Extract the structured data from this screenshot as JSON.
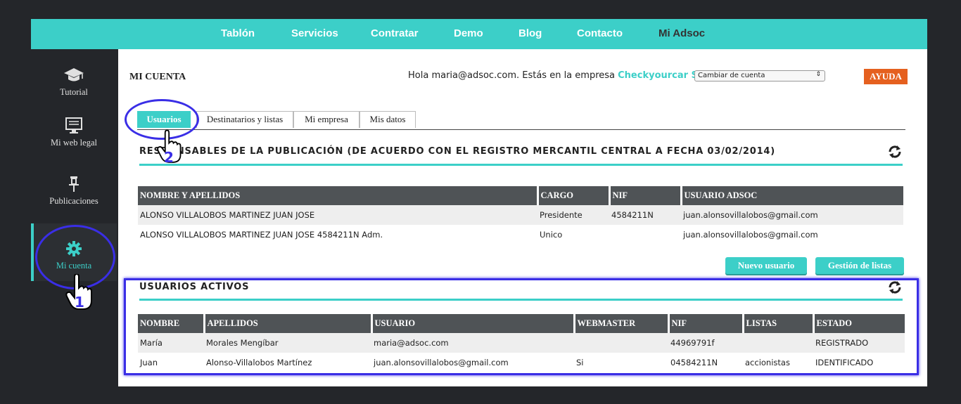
{
  "nav": {
    "items": [
      "Tablón",
      "Servicios",
      "Contratar",
      "Demo",
      "Blog",
      "Contacto",
      "Mi Adsoc"
    ]
  },
  "sidebar": {
    "items": [
      {
        "label": "Tutorial",
        "icon": "graduation-cap-icon"
      },
      {
        "label": "Mi web legal",
        "icon": "monitor-icon"
      },
      {
        "label": "Publicaciones",
        "icon": "pushpin-icon"
      },
      {
        "label": "Mi cuenta",
        "icon": "gear-icon"
      }
    ],
    "active": "Mi cuenta"
  },
  "header": {
    "title": "MI CUENTA",
    "greeting": "Hola maria@adsoc.com. Estás en la empresa",
    "company": "Checkyourcar S.L.",
    "account_select": "Cambiar de cuenta",
    "help_label": "AYUDA"
  },
  "tabs": [
    "Usuarios",
    "Destinatarios y listas",
    "Mi empresa",
    "Mis datos"
  ],
  "responsables": {
    "title": "RESPONSABLES DE LA PUBLICACIÓN (DE ACUERDO CON EL REGISTRO MERCANTIL CENTRAL A FECHA 03/02/2014)",
    "columns": [
      "NOMBRE Y APELLIDOS",
      "CARGO",
      "NIF",
      "USUARIO ADSOC"
    ],
    "rows": [
      [
        "ALONSO VILLALOBOS MARTINEZ JUAN JOSE",
        "Presidente",
        "4584211N",
        "juan.alonsovillalobos@gmail.com"
      ],
      [
        "ALONSO VILLALOBOS MARTINEZ JUAN JOSE 4584211N Adm.",
        "Unico",
        "",
        "juan.alonsovillalobos@gmail.com"
      ]
    ]
  },
  "buttons": {
    "new_user": "Nuevo usuario",
    "manage_lists": "Gestión de listas"
  },
  "usuarios": {
    "title": "USUARIOS ACTIVOS",
    "columns": [
      "NOMBRE",
      "APELLIDOS",
      "USUARIO",
      "WEBMASTER",
      "NIF",
      "LISTAS",
      "ESTADO"
    ],
    "rows": [
      [
        "María",
        "Morales Mengíbar",
        "maria@adsoc.com",
        "",
        "44969791f",
        "",
        "REGISTRADO"
      ],
      [
        "Juan",
        "Alonso-Villalobos Martínez",
        "juan.alonsovillalobos@gmail.com",
        "Si",
        "04584211N",
        "accionistas",
        "IDENTIFICADO"
      ]
    ]
  },
  "annotations": [
    "1",
    "2"
  ],
  "colors": {
    "accent": "#3ccfc8",
    "help": "#e5601f",
    "annotation": "#3a2ee6",
    "dark": "#24262a"
  }
}
